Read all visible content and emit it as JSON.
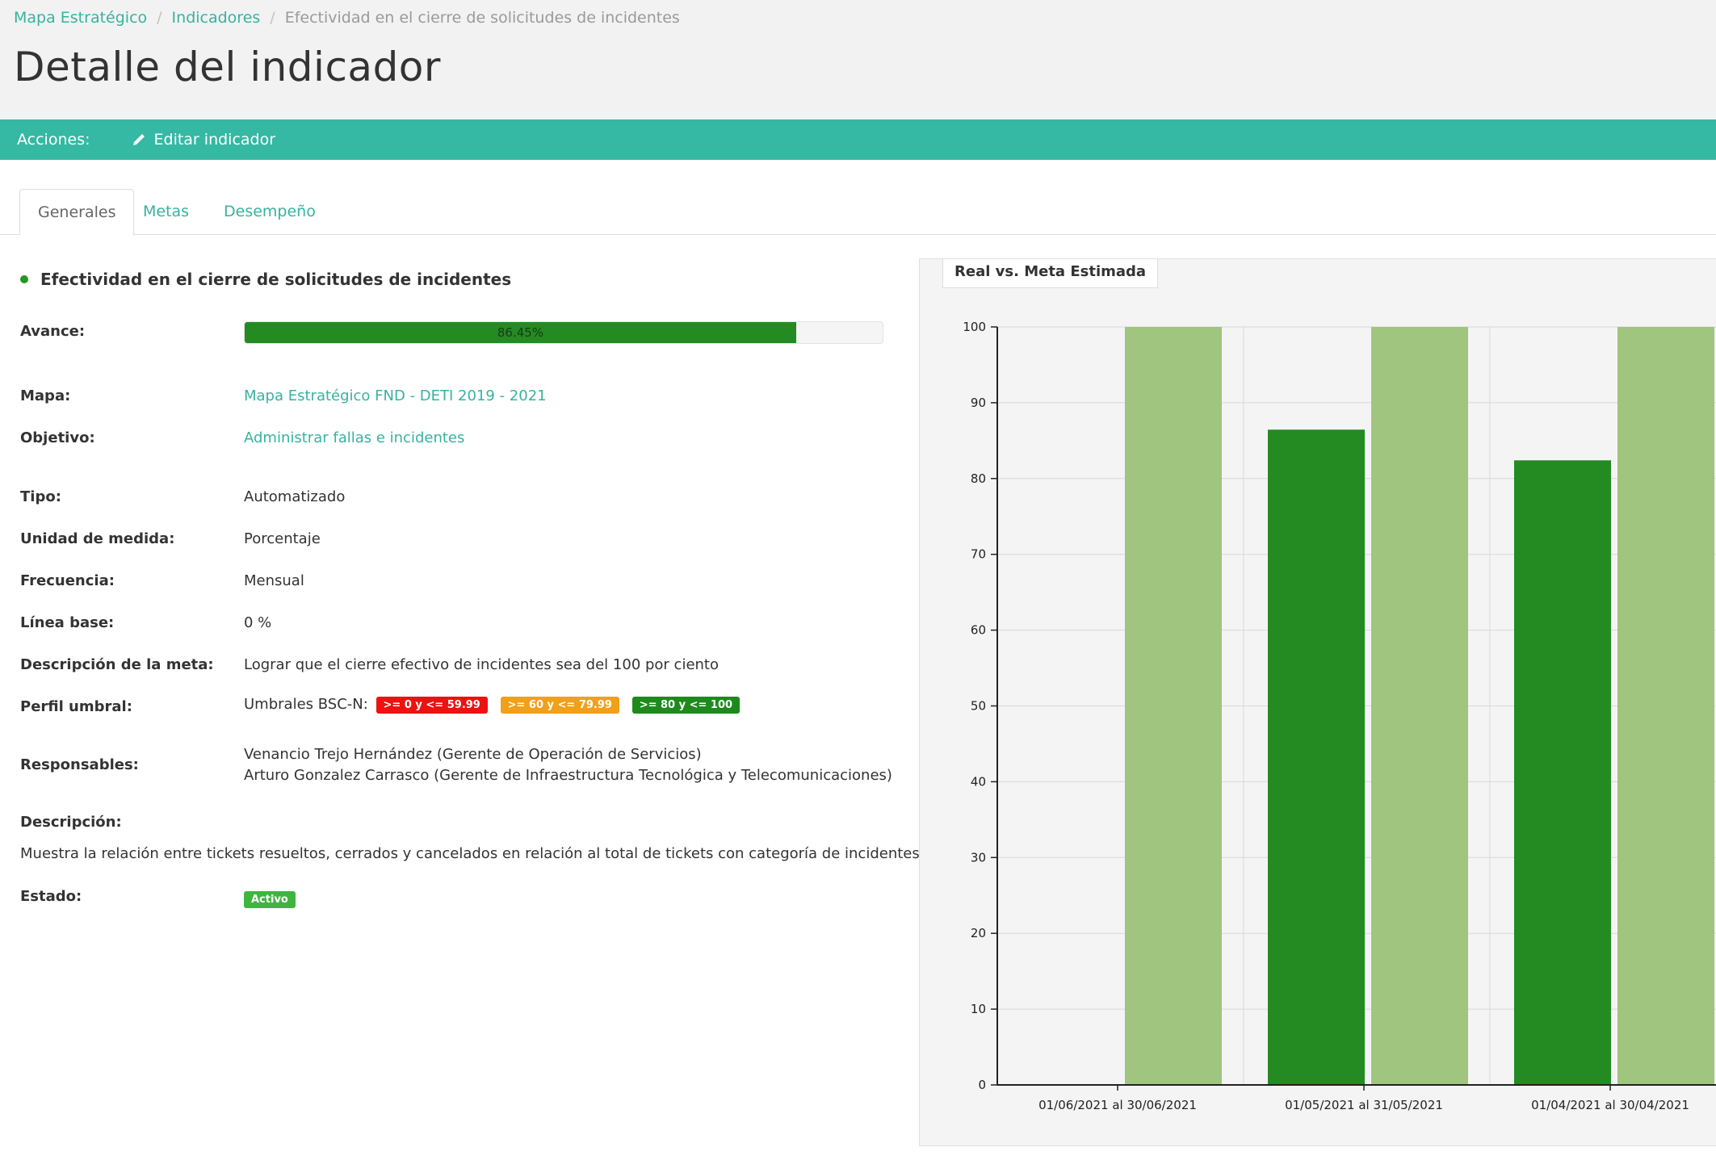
{
  "breadcrumb": {
    "items": [
      "Mapa Estratégico",
      "Indicadores"
    ],
    "current": "Efectividad en el cierre de solicitudes de incidentes"
  },
  "page_title": "Detalle del indicador",
  "actions": {
    "label": "Acciones:",
    "edit_label": "Editar indicador",
    "edit_icon": "pencil-icon"
  },
  "tabs": [
    {
      "label": "Generales",
      "active": true
    },
    {
      "label": "Metas",
      "active": false
    },
    {
      "label": "Desempeño",
      "active": false
    }
  ],
  "indicator": {
    "title": "Efectividad en el cierre de solicitudes de incidentes",
    "status_dot_color": "#229822",
    "avance_label": "Avance:",
    "avance_value": 86.45,
    "avance_text": "86.45%",
    "mapa_label": "Mapa:",
    "mapa_value": "Mapa Estratégico FND - DETI 2019 - 2021",
    "objetivo_label": "Objetivo:",
    "objetivo_value": "Administrar fallas e incidentes",
    "tipo_label": "Tipo:",
    "tipo_value": "Automatizado",
    "unidad_label": "Unidad de medida:",
    "unidad_value": "Porcentaje",
    "frecuencia_label": "Frecuencia:",
    "frecuencia_value": "Mensual",
    "linea_label": "Línea base:",
    "linea_value": "0 %",
    "desc_meta_label": "Descripción de la meta:",
    "desc_meta_value": "Lograr que el cierre efectivo de incidentes sea del 100 por ciento",
    "perfil_label": "Perfil umbral:",
    "perfil_prefix": "Umbrales BSC-N:",
    "umbrales": [
      {
        "text": ">= 0 y <= 59.99",
        "color": "#ee1111"
      },
      {
        "text": ">= 60 y <= 79.99",
        "color": "#f0a01a"
      },
      {
        "text": ">= 80 y <= 100",
        "color": "#1e8a1e"
      }
    ],
    "responsables_label": "Responsables:",
    "responsables": [
      "Venancio Trejo Hernández (Gerente de Operación de Servicios)",
      "Arturo Gonzalez Carrasco (Gerente de Infraestructura Tecnológica y Telecomunicaciones)"
    ],
    "descripcion_label": "Descripción:",
    "descripcion_value": "Muestra la relación entre tickets resueltos, cerrados y cancelados en relación al total de tickets con categoría de incidentes",
    "estado_label": "Estado:",
    "estado_value": "Activo"
  },
  "chart_data": {
    "type": "bar",
    "title": "Real vs. Meta Estimada",
    "categories": [
      "01/06/2021 al 30/06/2021",
      "01/05/2021 al 31/05/2021",
      "01/04/2021 al 30/04/2021"
    ],
    "series": [
      {
        "values": [
          0,
          86.45,
          82.4
        ],
        "color": "#238b22"
      },
      {
        "values": [
          100,
          100,
          100
        ],
        "color": "#9fc57e"
      }
    ],
    "ylim": [
      0,
      100
    ],
    "yticks": [
      0,
      10,
      20,
      30,
      40,
      50,
      60,
      70,
      80,
      90,
      100
    ],
    "grid": true
  }
}
